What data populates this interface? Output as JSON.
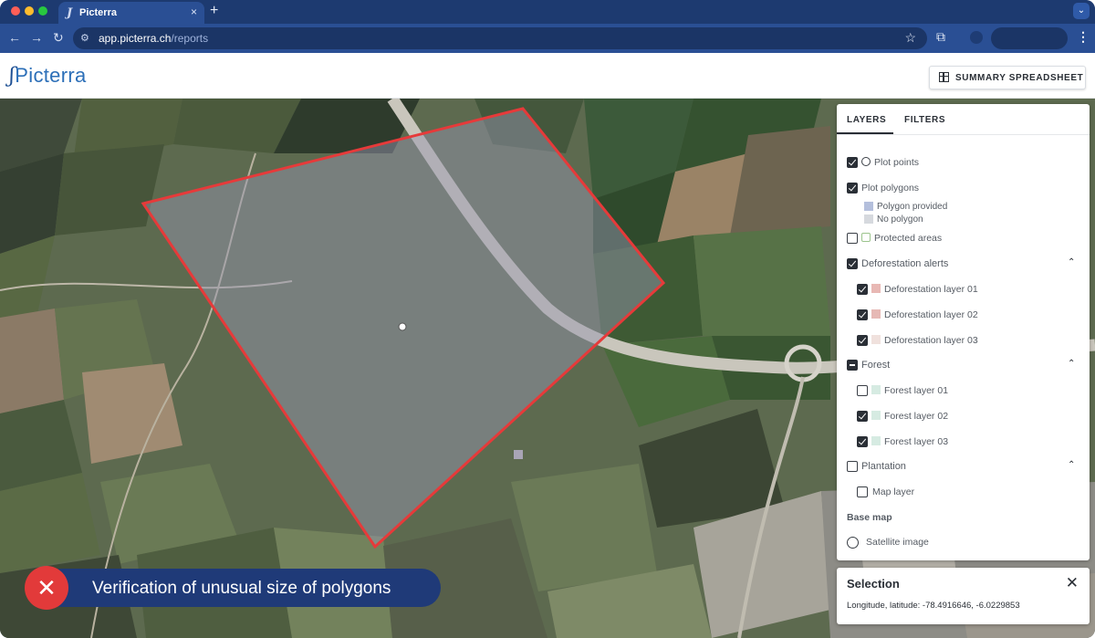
{
  "browser": {
    "tab_title": "Picterra",
    "tab_close": "×",
    "new_tab": "+",
    "tabs_menu": "⌄",
    "url_host": "app.picterra.ch",
    "url_path": "/reports",
    "back": "←",
    "forward": "→",
    "reload": "↻",
    "star": "☆",
    "extensions": "⧉",
    "menu": "⋮",
    "icons": [
      "picterra-favicon",
      "site-settings-icon",
      "bookmark-star-icon",
      "extensions-icon",
      "profile-icon",
      "kebab-menu-icon"
    ]
  },
  "app": {
    "logo_mark": "ʃ",
    "logo_text": "Picterra",
    "summary_button": "SUMMARY SPREADSHEET"
  },
  "panel": {
    "tabs": [
      "LAYERS",
      "FILTERS"
    ],
    "active_tab": "LAYERS",
    "items": {
      "plot_points": "Plot points",
      "plot_polygons": "Plot polygons",
      "polygon_provided": "Polygon provided",
      "no_polygon": "No polygon",
      "protected_areas": "Protected areas",
      "deforestation_alerts": "Deforestation alerts",
      "deforestation_layer_01": "Deforestation layer 01",
      "deforestation_layer_02": "Deforestation layer 02",
      "deforestation_layer_03": "Deforestation layer 03",
      "forest": "Forest",
      "forest_layer_01": "Forest layer 01",
      "forest_layer_02": "Forest layer 02",
      "forest_layer_03": "Forest layer 03",
      "plantation": "Plantation",
      "map_layer": "Map layer",
      "base_map": "Base map",
      "satellite_image": "Satellite image"
    },
    "checked": {
      "plot_points": true,
      "plot_polygons": true,
      "protected_areas": false,
      "deforestation_alerts": true,
      "deforestation_layer_01": true,
      "deforestation_layer_02": true,
      "deforestation_layer_03": true,
      "forest": "indeterminate",
      "forest_layer_01": false,
      "forest_layer_02": true,
      "forest_layer_03": true,
      "plantation": false,
      "map_layer": false,
      "satellite_image": false
    },
    "expand_icon": "⌃",
    "colors": {
      "polygon_provided": "#b4bfdc",
      "no_polygon": "#d6d9de",
      "deforestation_01": "#e8b8b4",
      "deforestation_02": "#e6b9b5",
      "deforestation_03": "#f0e1dd",
      "forest": "#d6ebe2"
    }
  },
  "selection": {
    "title": "Selection",
    "close": "✕",
    "coords": "Longitude, latitude: -78.4916646, -6.0229853"
  },
  "banner": {
    "icon": "✕",
    "text": "Verification of unusual size of polygons"
  },
  "colors": {
    "polygon_stroke": "#e63a3a",
    "browser_frame": "#1d3a70",
    "banner": "#1f3a78",
    "banner_icon": "#e23a3a"
  }
}
